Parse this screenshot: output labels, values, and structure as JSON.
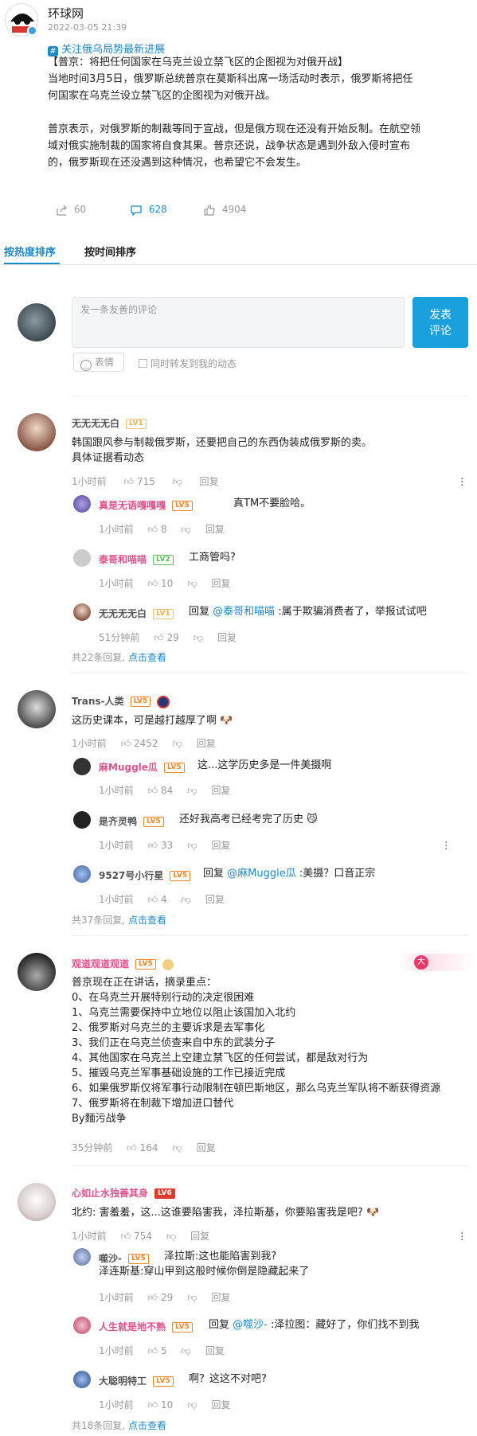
{
  "post": {
    "author": "环球网",
    "date": "2022-03-05 21:39",
    "topic": "关注俄乌局势最新进展",
    "headline": "【普京：将把任何国家在乌克兰设立禁飞区的企图视为对俄开战】",
    "body1a": "当地时间3月5日，俄罗斯总统普京在莫斯科出席一场活动时表示，俄罗斯将把任",
    "body1b": "何国家在乌克兰设立禁飞区的企图视为对俄开战。",
    "body2a": "普京表示，对俄罗斯的制裁等同于宣战，但是俄方现在还没有开始反制。在航空领",
    "body2b": "域对俄实施制裁的国家将自食其果。普京还说，战争状态是遇到外敌入侵时宣布",
    "body2c": "的，俄罗斯现在还没遇到这种情况，也希望它不会发生。",
    "repost_count": "60",
    "comment_count": "628",
    "like_count": "4904"
  },
  "tabs": {
    "hot": "按热度排序",
    "time": "按时间排序"
  },
  "composer": {
    "placeholder": "发一条友善的评论",
    "submit_line1": "发表",
    "submit_line2": "评论",
    "emoji": "表情",
    "forward": "同时转发到我的动态"
  },
  "common": {
    "reply": "回复",
    "more_prefix": "共",
    "more_suffix": "条回复,",
    "view": "点击查看",
    "reply_to": "回复"
  },
  "comments": [
    {
      "name": "无无无无白",
      "level": "LV1",
      "lines": [
        "韩国跟风参与制裁俄罗斯，还要把自己的东西伪装成俄罗斯的卖。",
        "具体证据看动态"
      ],
      "time": "1小时前",
      "likes": "715",
      "total": "22",
      "replies": [
        {
          "name": "真是无语嘎嘎嘎",
          "level": "LV5",
          "text": "真TM不要脸哈。",
          "time": "1小时前",
          "likes": "8"
        },
        {
          "name": "泰哥和喵喵",
          "level": "LV2",
          "text": "工商管吗?",
          "time": "1小时前",
          "likes": "10"
        },
        {
          "name": "无无无无白",
          "level": "LV1",
          "to": "@泰哥和喵喵",
          "text": ":属于欺骗消费者了，举报试试吧",
          "time": "51分钟前",
          "likes": "29"
        }
      ]
    },
    {
      "name": "Trans-人类",
      "level": "LV5",
      "lines": [
        "这历史课本，可是越打越厚了啊"
      ],
      "time": "1小时前",
      "likes": "2452",
      "total": "37",
      "replies": [
        {
          "name": "麻Muggle瓜",
          "level": "LV5",
          "text": "这...这学历史多是一件美摄啊",
          "time": "1小时前",
          "likes": "84"
        },
        {
          "name": "是齐灵鸭",
          "level": "LV5",
          "text": "还好我高考已经考完了历史",
          "time": "1小时前",
          "likes": "33"
        },
        {
          "name": "9527号小行星",
          "level": "LV5",
          "to": "@麻Muggle瓜",
          "text": ":美摄？口音正宗",
          "time": "1小时前",
          "likes": "4"
        }
      ]
    },
    {
      "name": "观道观道观道",
      "level": "LV5",
      "lines": [
        "普京现在正在讲话，摘录重点：",
        "0、在乌克兰开展特别行动的决定很困难",
        "1、乌克兰需要保持中立地位以阻止该国加入北约",
        "2、俄罗斯对乌克兰的主要诉求是去军事化",
        "3、我们正在乌克兰侦查来自中东的武装分子",
        "4、其他国家在乌克兰上空建立禁飞区的任何尝试，都是敌对行为",
        "5、摧毁乌克兰军事基础设施的工作已接近完成",
        "6、如果俄罗斯仅将军事行动限制在顿巴斯地区，那么乌克兰军队将不断获得资源",
        "7、俄罗斯将在制裁下增加进口替代",
        "By麵污战争"
      ],
      "time": "35分钟前",
      "likes": "164",
      "badge": "大"
    },
    {
      "name": "心如止水独善其身",
      "level": "LV6",
      "lines": [
        "北约: 害羞羞，这...这谁要陷害我，泽拉斯基，你要陷害我是吧?"
      ],
      "time": "1小时前",
      "likes": "754",
      "total": "18",
      "replies": [
        {
          "name": "噬沙-",
          "level": "LV5",
          "text": "泽拉斯:这也能陷害到我?",
          "text2": "泽连斯基:穿山甲到这般时候你倒是隐藏起来了",
          "time": "1小时前",
          "likes": "29"
        },
        {
          "name": "人生就是地不熟",
          "level": "LV5",
          "to": "@噬沙-",
          "text": ":泽拉图：藏好了，你们找不到我",
          "time": "1小时前",
          "likes": "5"
        },
        {
          "name": "大聪明特工",
          "level": "LV5",
          "text": "啊？这这不对吧?",
          "time": "1小时前",
          "likes": "10"
        }
      ]
    }
  ],
  "colors": {
    "accent": "#1e88c8",
    "submit_bg": "#1aa0dc",
    "pink_name": "#e0528a",
    "level": "#f0862a"
  }
}
